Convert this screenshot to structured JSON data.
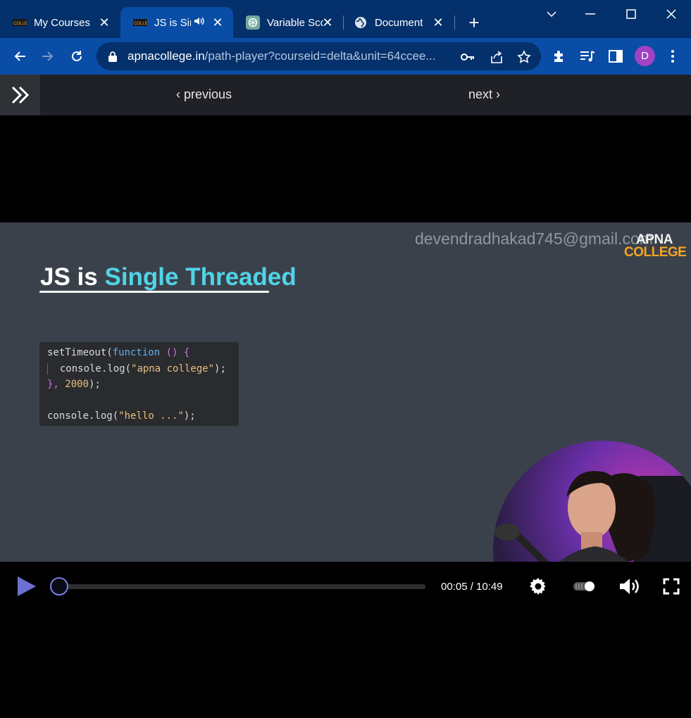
{
  "browser": {
    "tabs": [
      {
        "title": "My Courses",
        "icon": "apna-college-favicon"
      },
      {
        "title": "JS is Sin",
        "icon": "apna-college-favicon",
        "active": true,
        "audio": true
      },
      {
        "title": "Variable Sco",
        "icon": "chatgpt-favicon"
      },
      {
        "title": "Document",
        "icon": "globe-icon"
      }
    ],
    "url": {
      "domain": "apnacollege.in",
      "path": "/path-player?courseid=delta&unit=64ccee..."
    },
    "profile_initial": "D",
    "colors": {
      "frame": "#04306b",
      "toolbar": "#0a4da6",
      "profile": "#a142c4"
    }
  },
  "page": {
    "prev_label": "previous",
    "next_label": "next",
    "prev_chevron": "‹",
    "next_chevron": "›"
  },
  "video": {
    "watermark": "devendradhakad745@gmail.com",
    "brand_line1": "APNA",
    "brand_line2": "COLLEGE",
    "title_plain": "JS is",
    "title_highlight": "Single Threaded",
    "code_lines": {
      "l1_a": "setTimeout(",
      "l1_kw": "function",
      "l1_b": " () {",
      "l2": "console.log(",
      "l2_str": "\"apna college\"",
      "l2_end": ");",
      "l3_a": "},",
      "l3_num": " 2000",
      "l3_end": ");",
      "l5": "console.log(",
      "l5_str": "\"hello ...\"",
      "l5_end": ");"
    },
    "time_display": "00:05 / 10:49",
    "progress_fraction": 0.008,
    "accent_color": "#6c71d1"
  }
}
